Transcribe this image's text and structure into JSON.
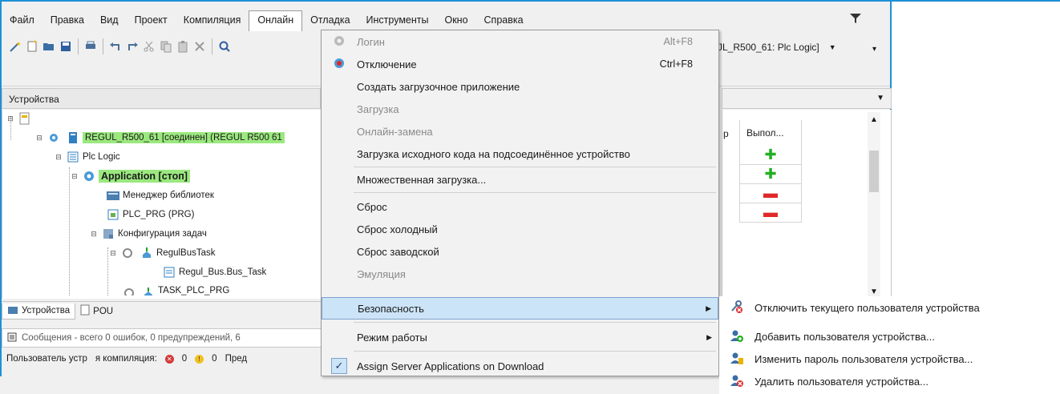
{
  "menubar": {
    "items": [
      "Файл",
      "Правка",
      "Вид",
      "Проект",
      "Компиляция",
      "Онлайн",
      "Отладка",
      "Инструменты",
      "Окно",
      "Справка"
    ],
    "open_index": 5
  },
  "toolbar": {
    "icons": [
      "magic-wand-icon",
      "new-file-icon",
      "open-folder-icon",
      "save-icon",
      "print-icon",
      "undo-icon",
      "redo-icon",
      "cut-icon",
      "copy-icon",
      "paste-icon",
      "delete-icon",
      "find-icon"
    ],
    "device_select": "JL_R500_61: Plc Logic]"
  },
  "devices_panel": {
    "title": "Устройства",
    "tree": {
      "device": "REGUL_R500_61 [соединен] (REGUL R500 61",
      "plc_logic": "Plc Logic",
      "application": "Application [стоп]",
      "library_manager": "Менеджер библиотек",
      "plc_prg": "PLC_PRG (PRG)",
      "task_config": "Конфигурация задач",
      "regul_bus_task": "RegulBusTask",
      "regul_bus_bus_task": "Regul_Bus.Bus_Task",
      "task_plc_prg": "TASK_PLC_PRG"
    }
  },
  "bottom_tabs": {
    "devices": "Устройства",
    "pou": "POU"
  },
  "messages": {
    "text": "Сообщения - всего 0 ошибок, 0 предупреждений, 6"
  },
  "statusbar": {
    "user": "Пользователь устр",
    "compile_label": "я компиляция:",
    "errors": "0",
    "warnings": "0",
    "tail": "Пред"
  },
  "right_panel": {
    "col_p": "р",
    "col_vyp": "Выпол...",
    "rows": [
      "plus",
      "plus",
      "minus",
      "minus"
    ]
  },
  "online_menu": {
    "items": [
      {
        "label": "Логин",
        "shortcut": "Alt+F8",
        "disabled": true,
        "icon": "login-gear-icon"
      },
      {
        "label": "Отключение",
        "shortcut": "Ctrl+F8",
        "disabled": false,
        "icon": "logout-gear-icon"
      },
      {
        "label": "Создать загрузочное приложение",
        "shortcut": "",
        "disabled": false
      },
      {
        "label": "Загрузка",
        "shortcut": "",
        "disabled": true
      },
      {
        "label": "Онлайн-замена",
        "shortcut": "",
        "disabled": true
      },
      {
        "label": "Загрузка исходного кода на подсоединённое устройство",
        "shortcut": "",
        "disabled": false
      },
      {
        "label": "Множественная загрузка...",
        "shortcut": "",
        "disabled": false
      },
      {
        "label": "Сброс",
        "shortcut": "",
        "disabled": false
      },
      {
        "label": "Сброс холодный",
        "shortcut": "",
        "disabled": false
      },
      {
        "label": "Сброс заводской",
        "shortcut": "",
        "disabled": false
      },
      {
        "label": "Эмуляция",
        "shortcut": "",
        "disabled": true
      },
      {
        "label": "Безопасность",
        "shortcut": "",
        "disabled": false,
        "submenu": true,
        "highlighted": true
      },
      {
        "label": "Режим работы",
        "shortcut": "",
        "disabled": false,
        "submenu": true
      },
      {
        "label": "Assign Server Applications on Download",
        "shortcut": "",
        "disabled": false,
        "checked": true
      }
    ]
  },
  "security_submenu": {
    "items": [
      {
        "label": "Отключить текущего пользователя устройства",
        "icon": "logout-user-icon"
      },
      {
        "label": "Добавить пользователя устройства...",
        "icon": "add-user-icon"
      },
      {
        "label": "Изменить пароль пользователя устройства...",
        "icon": "change-password-icon"
      },
      {
        "label": "Удалить пользователя устройства...",
        "icon": "remove-user-icon"
      }
    ]
  },
  "colors": {
    "accent": "#1e90d6",
    "highlight_green": "#9be87f",
    "menu_hover": "#cce4f7",
    "plus": "#22b022",
    "minus": "#e02828"
  }
}
